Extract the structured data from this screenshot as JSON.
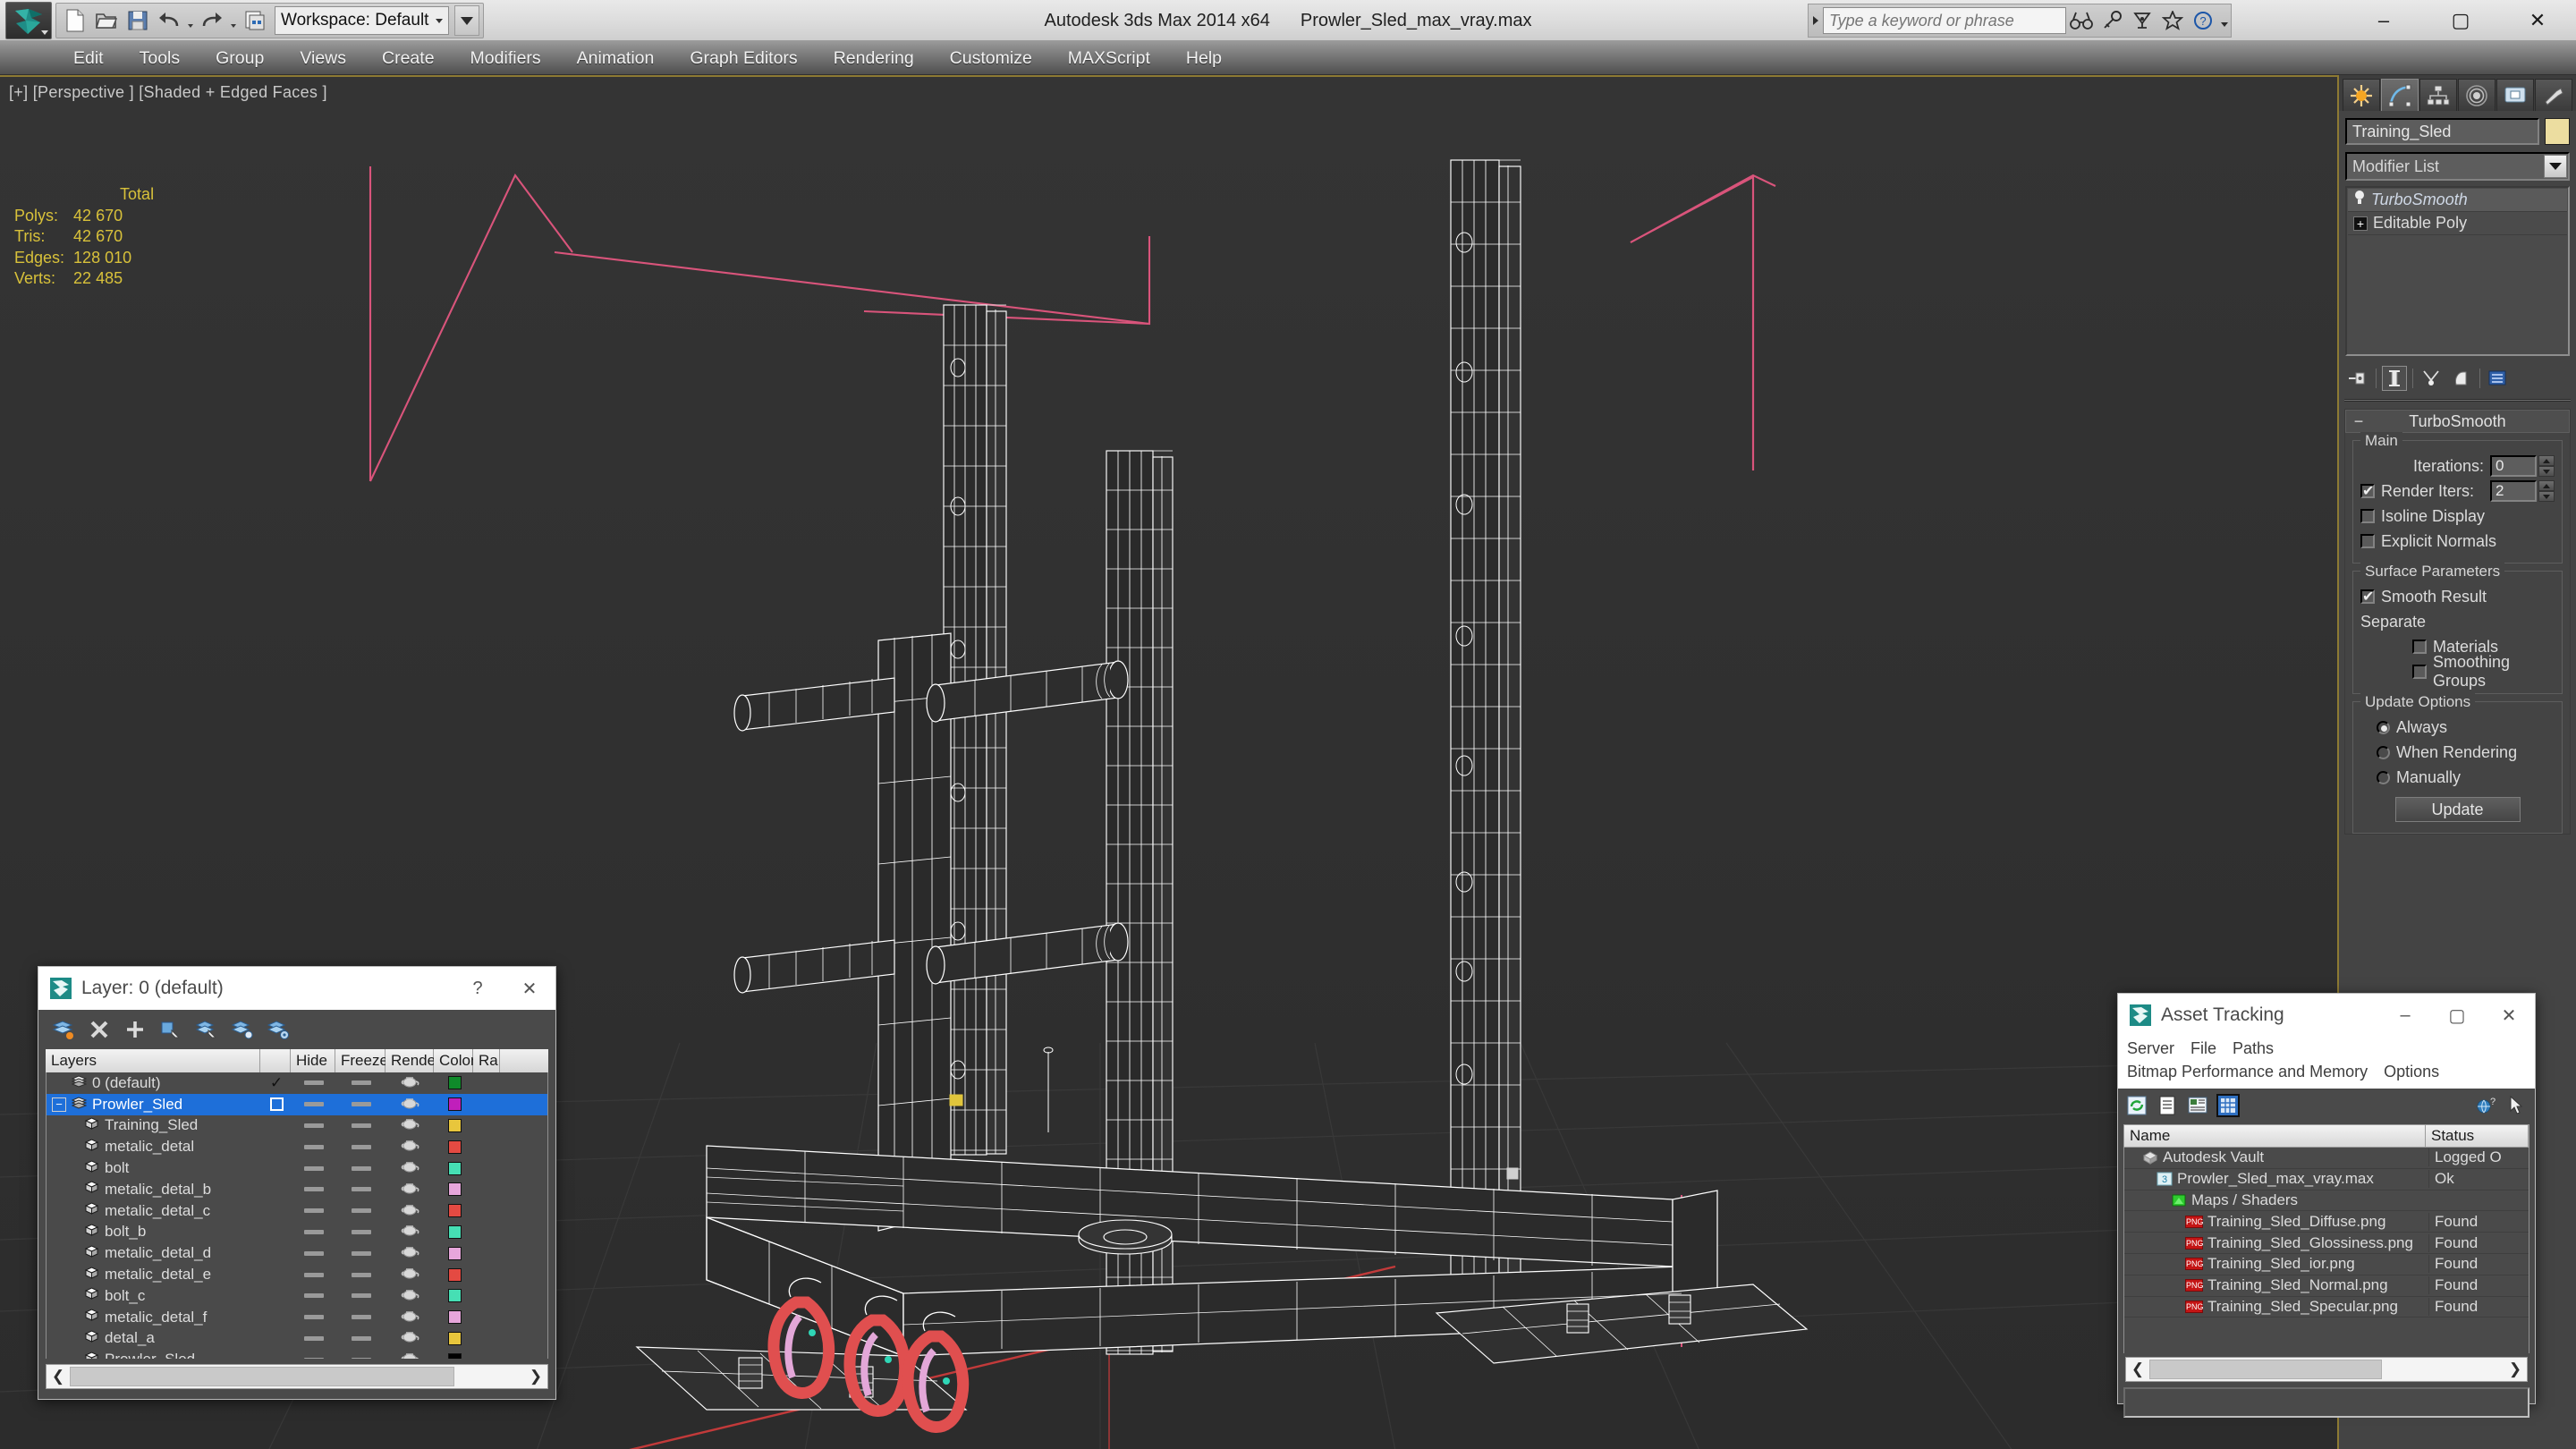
{
  "app": {
    "title": "Autodesk 3ds Max  2014 x64",
    "file": "Prowler_Sled_max_vray.max",
    "workspace_label": "Workspace: Default"
  },
  "quick_access": {
    "icons": [
      "new-file-icon",
      "open-file-icon",
      "save-file-icon",
      "undo-icon",
      "redo-icon",
      "set-project-folder-icon"
    ]
  },
  "search": {
    "placeholder": "Type a keyword or phrase",
    "value": "",
    "icons": [
      "binoculars-icon",
      "key-icon",
      "satellite-dish-icon",
      "star-icon",
      "help-circle-icon"
    ]
  },
  "window_controls": {
    "minimize": "–",
    "maximize": "▢",
    "close": "✕"
  },
  "menu": {
    "items": [
      "Edit",
      "Tools",
      "Group",
      "Views",
      "Create",
      "Modifiers",
      "Animation",
      "Graph Editors",
      "Rendering",
      "Customize",
      "MAXScript",
      "Help"
    ]
  },
  "viewport": {
    "label": "[+] [Perspective ] [Shaded + Edged Faces ]",
    "stats": {
      "header": "Total",
      "rows": [
        {
          "label": "Polys:",
          "value": "42 670"
        },
        {
          "label": "Tris:",
          "value": "42 670"
        },
        {
          "label": "Edges:",
          "value": "128 010"
        },
        {
          "label": "Verts:",
          "value": "22 485"
        }
      ]
    },
    "colors": {
      "background": "#2f2f2f",
      "wire": "#ffffff",
      "grid": "#3c3c3c",
      "helper_pink": "#d9547b",
      "axis_red": "#c23a3a",
      "detail_red": "#e04f4f",
      "detail_pink": "#e3a7d8",
      "detail_teal": "#2fd6b6"
    }
  },
  "command_panel": {
    "tabs": [
      "create-tab",
      "modify-tab",
      "hierarchy-tab",
      "motion-tab",
      "display-tab",
      "utilities-tab"
    ],
    "active_tab_index": 1,
    "object_name": "Training_Sled",
    "object_color": "#ecdda0",
    "modifier_list_label": "Modifier List",
    "stack": [
      {
        "label": "TurboSmooth",
        "selected": true
      },
      {
        "label": "Editable Poly",
        "selected": false
      }
    ],
    "stack_tools": [
      "pin-stack-icon",
      "show-end-result-icon",
      "make-unique-icon",
      "remove-modifier-icon",
      "configure-modifier-sets-icon"
    ],
    "rollout": {
      "title": "TurboSmooth",
      "main": {
        "caption": "Main",
        "iterations_label": "Iterations:",
        "iterations_value": "0",
        "render_iters_label": "Render Iters:",
        "render_iters_value": "2",
        "render_iters_checked": true,
        "isoline_display_label": "Isoline Display",
        "isoline_display_checked": false,
        "explicit_normals_label": "Explicit Normals",
        "explicit_normals_checked": false
      },
      "surface": {
        "caption": "Surface Parameters",
        "smooth_result_label": "Smooth Result",
        "smooth_result_checked": true,
        "separate_label": "Separate",
        "materials_label": "Materials",
        "materials_checked": false,
        "smoothing_groups_label": "Smoothing Groups",
        "smoothing_groups_checked": false
      },
      "update": {
        "caption": "Update Options",
        "options": [
          "Always",
          "When Rendering",
          "Manually"
        ],
        "selected_index": 0,
        "button_label": "Update"
      }
    }
  },
  "layer_window": {
    "title": "Layer: 0 (default)",
    "help_label": "?",
    "close_label": "✕",
    "toolbar_icons": [
      "create-new-layer-icon",
      "delete-layer-icon",
      "add-selection-icon",
      "select-objects-in-layer-icon",
      "select-highlighted-objects-icon",
      "highlight-selected-objects-icon",
      "layer-properties-icon"
    ],
    "columns": [
      "Layers",
      "",
      "Hide",
      "Freeze",
      "Render",
      "Color",
      "Ra"
    ],
    "rows": [
      {
        "name": "0 (default)",
        "icon": "layer-stack-icon",
        "indent": 1,
        "selected": false,
        "current": true,
        "hide": "dash",
        "freeze": "dash",
        "render": "teapot",
        "color": "#0f8a2a"
      },
      {
        "name": "Prowler_Sled",
        "icon": "layer-stack-icon",
        "indent": 0,
        "selected": true,
        "expander": "−",
        "current": false,
        "hide": "dash",
        "freeze": "dash",
        "render": "teapot",
        "color": "#c01fbb"
      },
      {
        "name": "Training_Sled",
        "icon": "object-box-icon",
        "indent": 2,
        "selected": false,
        "hide": "dash",
        "freeze": "dash",
        "render": "teapot",
        "color": "#e8c63c"
      },
      {
        "name": "metalic_detal",
        "icon": "object-box-icon",
        "indent": 2,
        "selected": false,
        "hide": "dash",
        "freeze": "dash",
        "render": "teapot",
        "color": "#e44a42"
      },
      {
        "name": "bolt",
        "icon": "object-box-icon",
        "indent": 2,
        "selected": false,
        "hide": "dash",
        "freeze": "dash",
        "render": "teapot",
        "color": "#46dfb4"
      },
      {
        "name": "metalic_detal_b",
        "icon": "object-box-icon",
        "indent": 2,
        "selected": false,
        "hide": "dash",
        "freeze": "dash",
        "render": "teapot",
        "color": "#e7a6db"
      },
      {
        "name": "metalic_detal_c",
        "icon": "object-box-icon",
        "indent": 2,
        "selected": false,
        "hide": "dash",
        "freeze": "dash",
        "render": "teapot",
        "color": "#e44a42"
      },
      {
        "name": "bolt_b",
        "icon": "object-box-icon",
        "indent": 2,
        "selected": false,
        "hide": "dash",
        "freeze": "dash",
        "render": "teapot",
        "color": "#46dfb4"
      },
      {
        "name": "metalic_detal_d",
        "icon": "object-box-icon",
        "indent": 2,
        "selected": false,
        "hide": "dash",
        "freeze": "dash",
        "render": "teapot",
        "color": "#e7a6db"
      },
      {
        "name": "metalic_detal_e",
        "icon": "object-box-icon",
        "indent": 2,
        "selected": false,
        "hide": "dash",
        "freeze": "dash",
        "render": "teapot",
        "color": "#e44a42"
      },
      {
        "name": "bolt_c",
        "icon": "object-box-icon",
        "indent": 2,
        "selected": false,
        "hide": "dash",
        "freeze": "dash",
        "render": "teapot",
        "color": "#46dfb4"
      },
      {
        "name": "metalic_detal_f",
        "icon": "object-box-icon",
        "indent": 2,
        "selected": false,
        "hide": "dash",
        "freeze": "dash",
        "render": "teapot",
        "color": "#e7a6db"
      },
      {
        "name": "detal_a",
        "icon": "object-box-icon",
        "indent": 2,
        "selected": false,
        "hide": "dash",
        "freeze": "dash",
        "render": "teapot",
        "color": "#e8c63c"
      },
      {
        "name": "Prowler_Sled",
        "icon": "object-box-icon",
        "indent": 2,
        "selected": false,
        "hide": "dash",
        "freeze": "dash",
        "render": "teapot",
        "color": "#000000"
      }
    ],
    "hscroll": {
      "left_arrow": "❮",
      "right_arrow": "❯"
    }
  },
  "asset_window": {
    "title": "Asset Tracking",
    "minimize": "–",
    "maximize": "▢",
    "close": "✕",
    "menu": [
      "Server",
      "File",
      "Paths",
      "Bitmap Performance and Memory",
      "Options"
    ],
    "toolbar_icons": [
      "refresh-icon",
      "list-view-icon",
      "details-view-icon",
      "grid-view-icon",
      "globe-help-icon",
      "cursor-icon"
    ],
    "columns": [
      "Name",
      "Status"
    ],
    "rows": [
      {
        "name": "Autodesk Vault",
        "status": "Logged O",
        "icon": "vault-icon",
        "indent": 1
      },
      {
        "name": "Prowler_Sled_max_vray.max",
        "status": "Ok",
        "icon": "max-file-icon",
        "indent": 2
      },
      {
        "name": "Maps / Shaders",
        "status": "",
        "icon": "maps-shaders-icon",
        "indent": 3
      },
      {
        "name": "Training_Sled_Diffuse.png",
        "status": "Found",
        "icon": "png-icon",
        "indent": 4
      },
      {
        "name": "Training_Sled_Glossiness.png",
        "status": "Found",
        "icon": "png-icon",
        "indent": 4
      },
      {
        "name": "Training_Sled_ior.png",
        "status": "Found",
        "icon": "png-icon",
        "indent": 4
      },
      {
        "name": "Training_Sled_Normal.png",
        "status": "Found",
        "icon": "png-icon",
        "indent": 4
      },
      {
        "name": "Training_Sled_Specular.png",
        "status": "Found",
        "icon": "png-icon",
        "indent": 4
      }
    ],
    "hscroll": {
      "left_arrow": "❮",
      "right_arrow": "❯"
    }
  }
}
